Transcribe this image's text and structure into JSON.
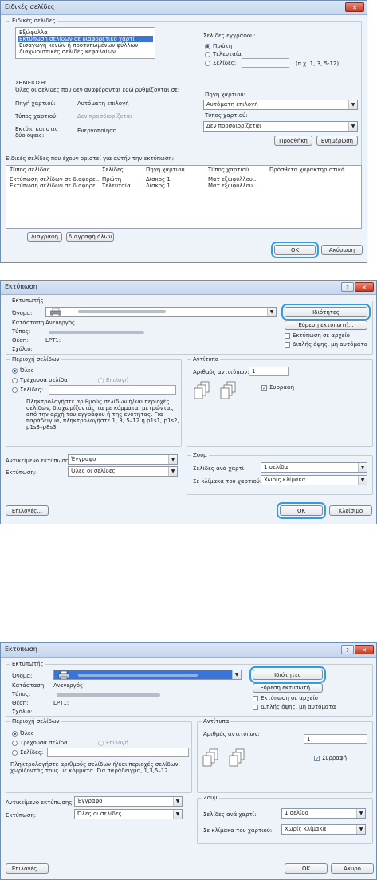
{
  "d1": {
    "title": "Ειδικές σελίδες",
    "group_label": "Ειδικές σελίδες",
    "list_items": [
      "Εξώφυλλα",
      "Εκτύπωση σελίδων σε διαφορετικό χαρτί",
      "Εισαγωγή κενών ή προτυπωμένων φύλλων",
      "Διαχωριστικές σελίδες κεφαλαίων"
    ],
    "pages_doc_label": "Σελίδες εγγράφου:",
    "radio_first": "Πρώτη",
    "radio_last": "Τελευταία",
    "radio_pages": "Σελίδες:",
    "pages_hint": "(π.χ. 1, 3, 5-12)",
    "note_title": "ΣΗΜΕΙΩΣΗ:",
    "note_text": "Όλες οι σελίδες που δεν αναφέρονται εδώ ρυθμίζονται σε:",
    "left_rows": [
      {
        "k": "Πηγή χαρτιού:",
        "v": "Αυτόματη επιλογή"
      },
      {
        "k": "Τύπος χαρτιού:",
        "v": "Δεν προσδιορίζεται"
      },
      {
        "k": "Εκτύπ. και στις δύο όψεις:",
        "v": "Ενεργοποίηση"
      }
    ],
    "source_label": "Πηγή χαρτιού:",
    "source_value": "Αυτόματη επιλογή",
    "type_label": "Τύπος χαρτιού:",
    "type_value": "Δεν προσδιορίζεται",
    "add_btn": "Προσθήκη",
    "update_btn": "Ενημέρωση",
    "table_caption": "Ειδικές σελίδες που έχουν οριστεί για αυτήν την εκτύπωση:",
    "table_headers": [
      "Τύπος σελίδας",
      "Σελίδες",
      "Πηγή χαρτιού",
      "Τύπος χαρτιού",
      "Πρόσθετα χαρακτηριστικά"
    ],
    "table_rows": [
      [
        "Εκτύπωση σελίδων σε διαφορε...",
        "Πρώτη",
        "Δίσκος 1",
        "Ματ εξωφύλλου...",
        ""
      ],
      [
        "Εκτύπωση σελίδων σε διαφορε...",
        "Τελευταία",
        "Δίσκος 1",
        "Ματ εξωφύλλου...",
        ""
      ]
    ],
    "delete_btn": "Διαγραφή",
    "delete_all_btn": "Διαγραφή όλων",
    "ok_btn": "OK",
    "cancel_btn": "Ακύρωση"
  },
  "d2": {
    "title": "Εκτύπωση",
    "printer_group": "Εκτυπωτής",
    "name_label": "Όνομα:",
    "status_label": "Κατάσταση:",
    "status_value": "Ανενεργός",
    "type_label": "Τύπος:",
    "where_label": "Θέση:",
    "where_value": "LPT1:",
    "comment_label": "Σχόλιο:",
    "props_btn": "Ιδιότητες",
    "find_btn": "Εύρεση εκτυπωτή...",
    "print_to_file": "Εκτύπωση σε αρχείο",
    "manual_duplex": "Διπλής όψης, μη αυτόματα",
    "range_group": "Περιοχή σελίδων",
    "all_label": "Όλες",
    "current_label": "Τρέχουσα σελίδα",
    "selection_label": "Επιλογή",
    "pages_label": "Σελίδες:",
    "pages_help": [
      "Πληκτρολογήστε αριθμούς σελίδων ή/και περιοχές",
      "σελίδων, διαχωρίζοντάς τα με κόμματα, μετρώντας",
      "από την αρχή του εγγράφου ή της ενότητας. Για",
      "παράδειγμα, πληκτρολογήστε 1, 3, 5–12 ή p1s1, p1s2,",
      "p1s3–p8s3"
    ],
    "copies_group": "Αντίτυπα",
    "copies_label": "Αριθμός αντιτύπων:",
    "copies_value": "1",
    "collate_label": "Συρραφή",
    "print_what_label": "Αντικείμενο εκτύπωσης:",
    "print_what_value": "Έγγραφο",
    "print_label": "Εκτύπωση:",
    "print_value": "Όλες οι σελίδες",
    "zoom_group": "Ζουμ",
    "pps_label": "Σελίδες ανά χαρτί:",
    "pps_value": "1 σελίδα",
    "scale_label": "Σε κλίμακα του χαρτιού:",
    "scale_value": "Χωρίς κλίμακα",
    "options_btn": "Επιλογές...",
    "ok_btn": "OK",
    "cancel_btn": "Κλείσιμο"
  },
  "d3": {
    "title": "Εκτύπωση",
    "printer_group": "Εκτυπωτής",
    "name_label": "Όνομα:",
    "status_label": "Κατάσταση:",
    "status_value": "Ανενεργός",
    "type_label": "Τύπος:",
    "where_label": "Θέση:",
    "where_value": "LPT1:",
    "comment_label": "Σχόλιο:",
    "props_btn": "Ιδιότητες",
    "find_btn": "Εύρεση εκτυπωτή...",
    "print_to_file": "Εκτύπωση σε αρχείο",
    "manual_duplex": "Διπλής όψης, μη αυτόματα",
    "range_group": "Περιοχή σελίδων",
    "all_label": "Όλες",
    "current_label": "Τρέχουσα σελίδα",
    "selection_label": "Επιλογή",
    "pages_label": "Σελίδες:",
    "pages_help": [
      "Πληκτρολογήστε αριθμούς σελίδων ή/και περιοχές σελίδων,",
      "χωρίζοντάς τους με κόμματα. Για παράδειγμα, 1,3,5–12"
    ],
    "copies_group": "Αντίτυπα",
    "copies_label": "Αριθμός αντιτύπων:",
    "copies_value": "1",
    "collate_label": "Συρραφή",
    "print_what_label": "Αντικείμενο εκτύπωσης:",
    "print_what_value": "Έγγραφο",
    "print_label": "Εκτύπωση:",
    "print_value": "Όλες οι σελίδες",
    "zoom_group": "Ζουμ",
    "pps_label": "Σελίδες ανά χαρτί:",
    "pps_value": "1 σελίδα",
    "scale_label": "Σε κλίμακα του χαρτιού:",
    "scale_value": "Χωρίς κλίμακα",
    "options_btn": "Επιλογές...",
    "ok_btn": "OK",
    "cancel_btn": "Άκυρο"
  }
}
